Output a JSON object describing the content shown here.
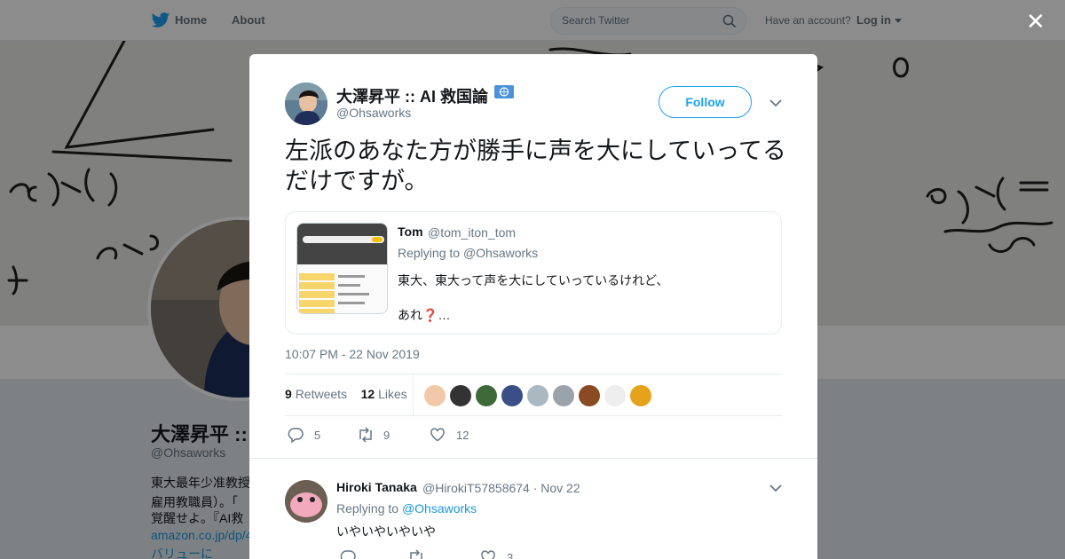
{
  "topbar": {
    "home_label": "Home",
    "about_label": "About",
    "search_placeholder": "Search Twitter",
    "account_prompt": "Have an account?",
    "login_label": "Log in"
  },
  "profile": {
    "name": "大澤昇平 ::",
    "handle": "@Ohsaworks",
    "bio_lines": [
      "東大最年少准教授",
      "雇用教職員）。「",
      "覚醒せよ。『AI救",
      "amazon.co.jp/dp/4",
      "バリューに"
    ]
  },
  "tweet": {
    "author_name": "大澤昇平 :: AI 救国論",
    "author_handle": "@Ohsaworks",
    "follow_label": "Follow",
    "text": "左派のあなた方が勝手に声を大にしていってるだけですが。",
    "quoted": {
      "name": "Tom",
      "handle": "@tom_iton_tom",
      "replying_prefix": "Replying to",
      "replying_to": "@Ohsaworks",
      "line1": "東大、東大って声を大にしていっているけれど、",
      "line2a": "あれ",
      "qmark": "❓",
      "line2b": "…"
    },
    "timestamp": "10:07 PM - 22 Nov 2019",
    "retweets_count": "9",
    "retweets_label": "Retweets",
    "likes_count": "12",
    "likes_label": "Likes",
    "reply_count": "5",
    "retweet_action_count": "9",
    "like_action_count": "12"
  },
  "reply": {
    "name": "Hiroki Tanaka",
    "handle_date": "@HirokiT57858674 · Nov 22",
    "replying_prefix": "Replying to",
    "replying_to": "@Ohsaworks",
    "text": "いやいやいやいや",
    "like_count": "3"
  },
  "colors": {
    "brand": "#1da1f2",
    "link": "#1b95e0"
  }
}
